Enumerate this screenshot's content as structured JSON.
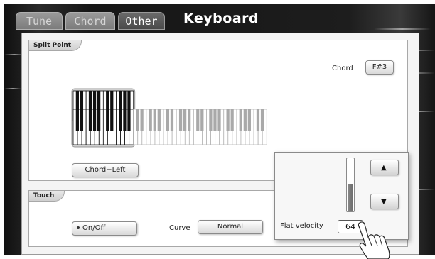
{
  "tabs": [
    {
      "label": "Tune",
      "active": false
    },
    {
      "label": "Chord",
      "active": false
    },
    {
      "label": "Other",
      "active": true
    }
  ],
  "page_title": "Keyboard",
  "split_point": {
    "section_label": "Split Point",
    "chord_label": "Chord",
    "chord_value": "F#3",
    "mode_button": "Chord+Left"
  },
  "touch": {
    "section_label": "Touch",
    "onoff_button": "On/Off",
    "curve_label": "Curve",
    "curve_value": "Normal"
  },
  "velocity_popup": {
    "flat_velocity_label": "Flat velocity",
    "flat_velocity_value": "64",
    "slider_level_fraction": 0.5,
    "up_icon": "triangle-up-icon",
    "down_icon": "triangle-down-icon"
  },
  "icons": {
    "onoff_indicator": "dot-icon",
    "pointer": "pointing-hand-icon"
  },
  "colors": {
    "backdrop": "#1d1d1d",
    "active_tab": "#5a5a5a",
    "inactive_tab": "#8a8a8a",
    "panel": "#f4f4f4"
  }
}
